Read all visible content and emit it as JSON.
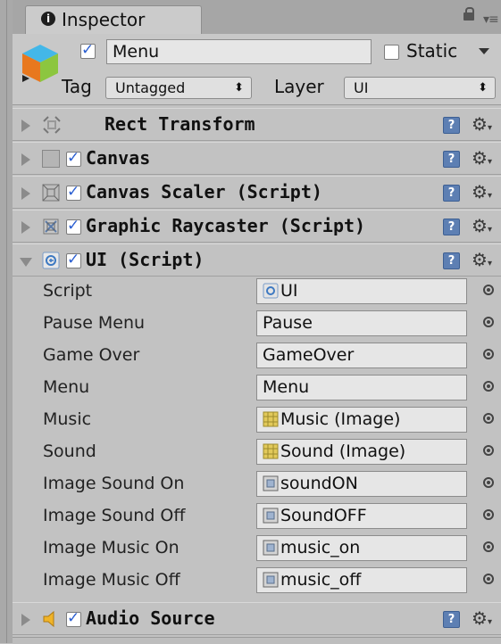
{
  "tab": {
    "title": "Inspector",
    "icon": "info-icon"
  },
  "object": {
    "active": true,
    "name": "Menu",
    "static_label": "Static",
    "static_checked": false,
    "tag_label": "Tag",
    "tag_value": "Untagged",
    "layer_label": "Layer",
    "layer_value": "UI"
  },
  "components": [
    {
      "title": "Rect Transform",
      "icon": "rect-transform-icon",
      "expanded": false,
      "has_checkbox": false
    },
    {
      "title": "Canvas",
      "icon": "canvas-icon",
      "expanded": false,
      "has_checkbox": true,
      "enabled": true
    },
    {
      "title": "Canvas Scaler (Script)",
      "icon": "canvas-scaler-icon",
      "expanded": false,
      "has_checkbox": true,
      "enabled": true
    },
    {
      "title": "Graphic Raycaster (Script)",
      "icon": "graphic-raycaster-icon",
      "expanded": false,
      "has_checkbox": true,
      "enabled": true
    },
    {
      "title": "UI (Script)",
      "icon": "csharp-script-icon",
      "expanded": true,
      "has_checkbox": true,
      "enabled": true
    },
    {
      "title": "Audio Source",
      "icon": "audio-source-icon",
      "expanded": false,
      "has_checkbox": true,
      "enabled": true
    }
  ],
  "properties": [
    {
      "label": "Script",
      "value": "UI",
      "value_icon": "script-icon"
    },
    {
      "label": "Pause Menu",
      "value": "Pause",
      "value_icon": ""
    },
    {
      "label": "Game Over",
      "value": "GameOver",
      "value_icon": ""
    },
    {
      "label": "Menu",
      "value": "Menu",
      "value_icon": ""
    },
    {
      "label": "Music",
      "value": "Music (Image)",
      "value_icon": "image-component-icon"
    },
    {
      "label": "Sound",
      "value": "Sound (Image)",
      "value_icon": "image-component-icon"
    },
    {
      "label": "Image Sound On",
      "value": "soundON",
      "value_icon": "sprite-icon"
    },
    {
      "label": "Image Sound Off",
      "value": "SoundOFF",
      "value_icon": "sprite-icon"
    },
    {
      "label": "Image Music On",
      "value": "music_on",
      "value_icon": "sprite-icon"
    },
    {
      "label": "Image Music Off",
      "value": "music_off",
      "value_icon": "sprite-icon"
    }
  ],
  "colors": {
    "panel": "#c2c2c2",
    "tab_bar": "#a6a6a6",
    "field": "#e6e6e6",
    "check_mark": "#2b5fd1",
    "help_icon": "#5d7fb3"
  }
}
